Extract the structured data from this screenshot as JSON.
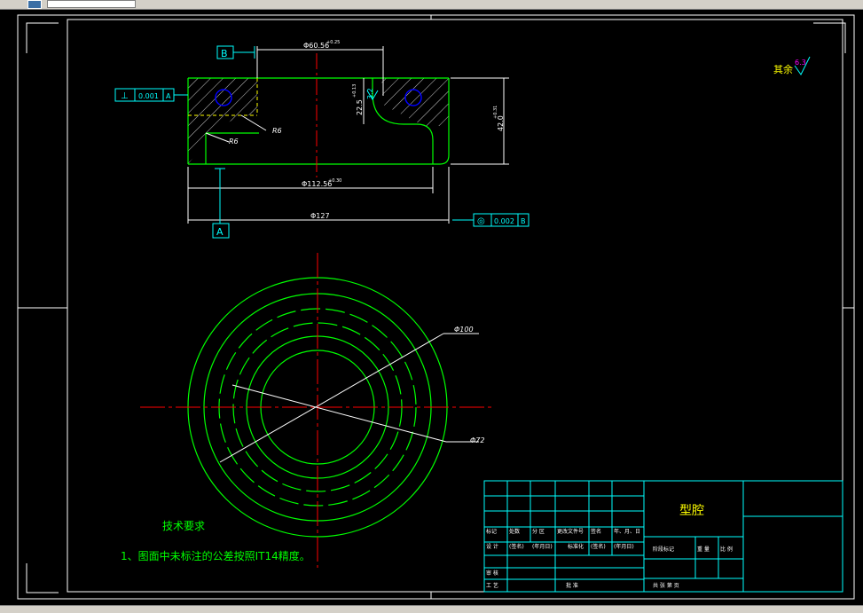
{
  "colors": {
    "background": "#000000",
    "border": "#ffffff",
    "part_outline": "#00ff00",
    "hatch": "#ffffff",
    "centerline": "#ff0000",
    "dimension": "#ffffff",
    "callout": "#00ffff",
    "hole": "#0000ff",
    "title_text": "#00ff00",
    "finish_label": "#ffff00",
    "finish_value": "#ff00ff",
    "title_block": "#00ffff"
  },
  "section_view": {
    "datum_b": "B",
    "datum_a": "A",
    "dim_top_diameter": "Φ60.56",
    "dim_top_tol": "+0.25",
    "dim_mid_diameter": "Φ112.56",
    "dim_mid_tol": "+0.30",
    "dim_overall_diameter": "Φ127",
    "dim_height": "42.0",
    "dim_height_tol": "+0.31",
    "dim_step": "22.5",
    "dim_step_tol": "+0.13",
    "radius_label_1": "R6",
    "radius_label_2": "R6",
    "roughness_local": "3.2",
    "gtol_flatness": {
      "symbol": "⊥",
      "value": "0.001",
      "datum": "A"
    },
    "gtol_concentric": {
      "symbol": "◎",
      "value": "0.002",
      "datum": "B"
    }
  },
  "plan_view": {
    "dim_outer": "Φ100",
    "dim_inner": "Φ72"
  },
  "surface_finish": {
    "label": "其余",
    "value": "6.3"
  },
  "technical_requirements": {
    "heading": "技术要求",
    "item_1": "1、图面中未标注的公差按照IT14精度。"
  },
  "title_block": {
    "part_name": "型腔",
    "row_headers": [
      "标记",
      "处数",
      "分  区",
      "更改文件号",
      "签名",
      "年、月、日"
    ],
    "design_label": "设  计",
    "design_name": "(签名)",
    "design_date": "(年月日)",
    "std_label": "标准化",
    "std_name": "(签名)",
    "std_date": "(年月日)",
    "stage_label": "阶段标记",
    "weight_label": "重  量",
    "scale_label": "比  例",
    "review_label": "审  核",
    "process_label": "工  艺",
    "approve_label": "批  准",
    "sheet_label": "共    张   第    页"
  }
}
